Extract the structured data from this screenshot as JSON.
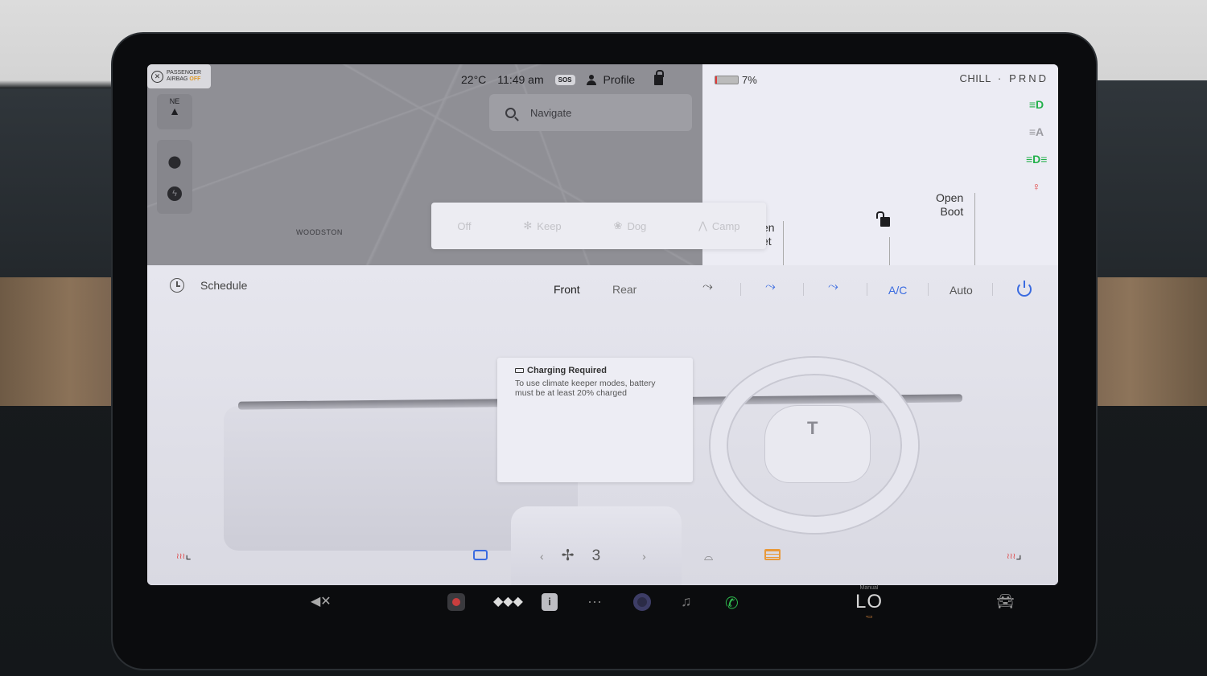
{
  "status_bar": {
    "airbag_line1": "PASSENGER",
    "airbag_line2": "AIRBAG",
    "airbag_state": "OFF",
    "temperature": "22°C",
    "time": "11:49 am",
    "sos_label": "SOS",
    "profile_label": "Profile",
    "battery_percent_text": "7%",
    "battery_level": 0.07,
    "drive_mode": "CHILL",
    "gear": "PRND"
  },
  "map": {
    "compass_heading": "NE",
    "location_label": "WOODSTON",
    "search_placeholder": "Navigate"
  },
  "car_panel": {
    "frunk_label_line1": "en",
    "frunk_label_line2": "et",
    "boot_label_line1": "Open",
    "boot_label_line2": "Boot"
  },
  "climate_keeper": {
    "options": [
      "Off",
      "Keep",
      "Dog",
      "Camp"
    ]
  },
  "climate": {
    "schedule_label": "Schedule",
    "front_label": "Front",
    "rear_label": "Rear",
    "ac_label": "A/C",
    "auto_label": "Auto",
    "fan_speed": "3",
    "warning_title": "Charging Required",
    "warning_body": "To use climate keeper modes, battery must be at least 20% charged",
    "accent_color": "#3a6be0"
  },
  "dock": {
    "cabin_temp_mode": "Manual",
    "cabin_temp": "LO"
  }
}
